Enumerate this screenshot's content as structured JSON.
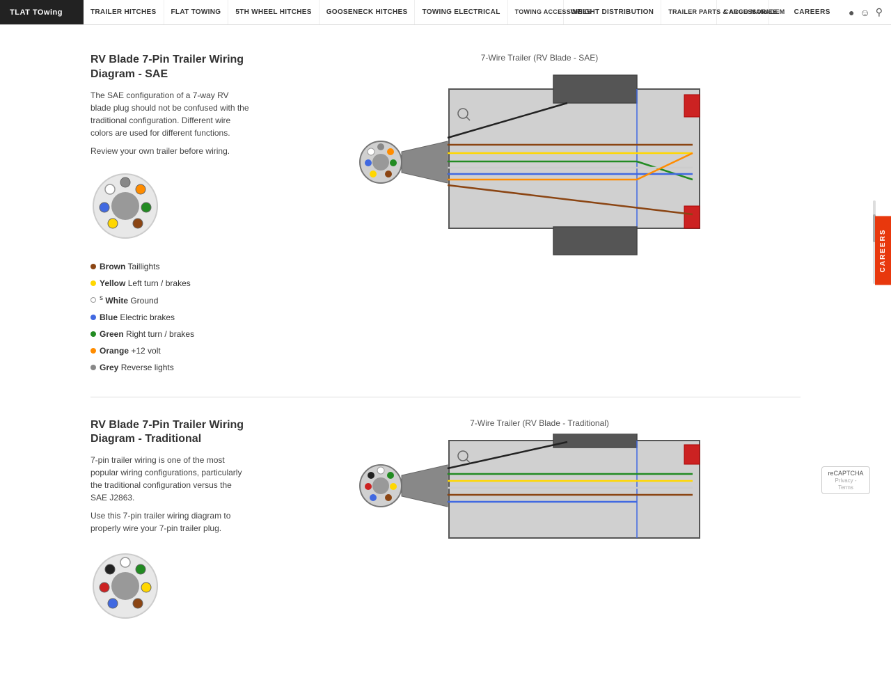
{
  "brand": {
    "logo_line1": "TLAT",
    "logo_line2": "TOwing"
  },
  "nav": {
    "items": [
      {
        "id": "trailer-hitches",
        "label": "TRAILER HITCHES"
      },
      {
        "id": "flat-towing",
        "label": "FLAT TOWING"
      },
      {
        "id": "5th-wheel",
        "label": "5TH WHEEL HITCHES"
      },
      {
        "id": "gooseneck",
        "label": "GOOSENECK HITCHES"
      },
      {
        "id": "towing-electrical",
        "label": "TOWING ELECTRICAL"
      },
      {
        "id": "towing-accessories",
        "label": "TOWING ACCESSORIES"
      },
      {
        "id": "weight-distribution",
        "label": "WEIGHT DISTRIBUTION"
      },
      {
        "id": "trailer-parts",
        "label": "TRAILER PARTS & ACCESSORIES"
      },
      {
        "id": "cargo-management",
        "label": "CARGO MANAGEMENT"
      },
      {
        "id": "careers",
        "label": "CAREERS"
      }
    ]
  },
  "careers_tab": "CAREERS",
  "sections": [
    {
      "id": "sae",
      "title": "RV Blade 7-Pin Trailer Wiring Diagram - SAE",
      "desc1": "The SAE configuration of a 7-way RV blade plug should not be confused with the traditional configuration. Different wire colors are used for different functions.",
      "desc2": "Review your own trailer before wiring.",
      "diagram_title": "7-Wire Trailer (RV Blade - SAE)",
      "legend": [
        {
          "color": "#8B4513",
          "label": "Brown",
          "desc": "Taillights"
        },
        {
          "color": "#FFD700",
          "label": "Yellow",
          "desc": "Left turn / brakes"
        },
        {
          "color": "#fff",
          "label": "White",
          "desc": "Ground",
          "border": "#999"
        },
        {
          "color": "#4169E1",
          "label": "Blue",
          "desc": "Electric brakes"
        },
        {
          "color": "#228B22",
          "label": "Green",
          "desc": "Right turn / brakes"
        },
        {
          "color": "#FF8C00",
          "label": "Orange",
          "desc": "+12 volt"
        },
        {
          "color": "#888",
          "label": "Grey",
          "desc": "Reverse lights"
        }
      ]
    },
    {
      "id": "traditional",
      "title": "RV Blade 7-Pin Trailer Wiring Diagram - Traditional",
      "desc1": "7-pin trailer wiring is one of the most popular wiring configurations, particularly the traditional configuration versus the SAE J2863.",
      "desc2": "Use this 7-pin trailer wiring diagram to properly wire your 7-pin trailer plug.",
      "diagram_title": "7-Wire Trailer (RV Blade - Traditional)"
    }
  ],
  "recaptcha_label": "reCAPTCHA"
}
